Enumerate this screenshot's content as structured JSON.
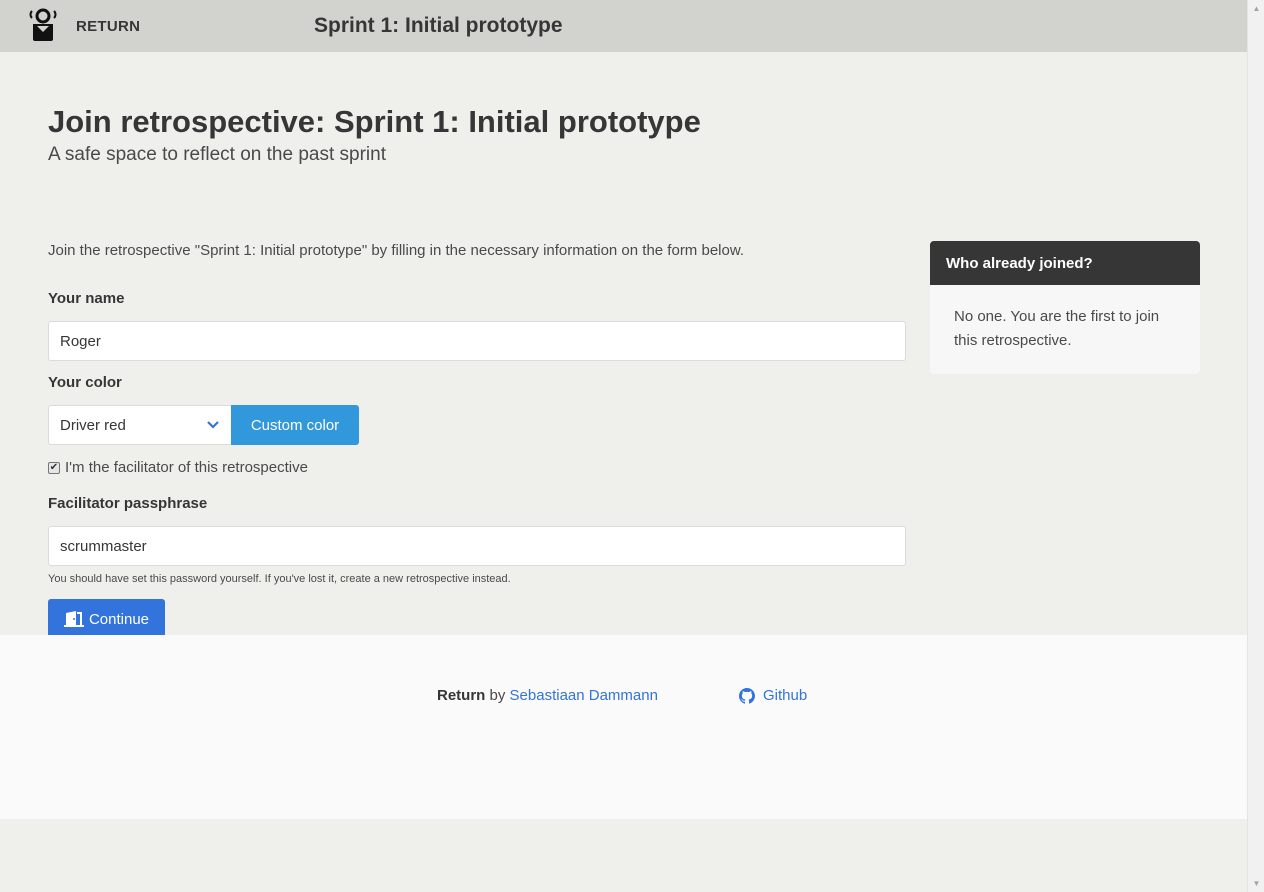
{
  "navbar": {
    "brand_label": "RETURN",
    "title": "Sprint 1: Initial prototype"
  },
  "main": {
    "heading": "Join retrospective: Sprint 1: Initial prototype",
    "subtitle": "A safe space to reflect on the past sprint",
    "intro": "Join the retrospective \"Sprint 1: Initial prototype\" by filling in the necessary information on the form below."
  },
  "form": {
    "name_label": "Your name",
    "name_value": "Roger",
    "color_label": "Your color",
    "color_selected": "Driver red",
    "custom_color_label": "Custom color",
    "facilitator_checked": true,
    "facilitator_label": "I'm the facilitator of this retrospective",
    "passphrase_label": "Facilitator passphrase",
    "passphrase_value": "scrummaster",
    "passphrase_help": "You should have set this password yourself. If you've lost it, create a new retrospective instead.",
    "continue_label": "Continue"
  },
  "panel": {
    "title": "Who already joined?",
    "body": "No one. You are the first to join this retrospective."
  },
  "footer": {
    "app_name": "Return",
    "by": "by",
    "author": "Sebastiaan Dammann",
    "github": "Github"
  },
  "colors": {
    "navbar": "#d2d2ce",
    "primary": "#3273dc",
    "info": "#3298dc",
    "panel_head": "#363636",
    "background": "#efefeb"
  },
  "icons": {
    "brand": "return-logo-icon",
    "select": "chevron-down-icon",
    "continue": "door-icon",
    "github": "github-icon"
  }
}
